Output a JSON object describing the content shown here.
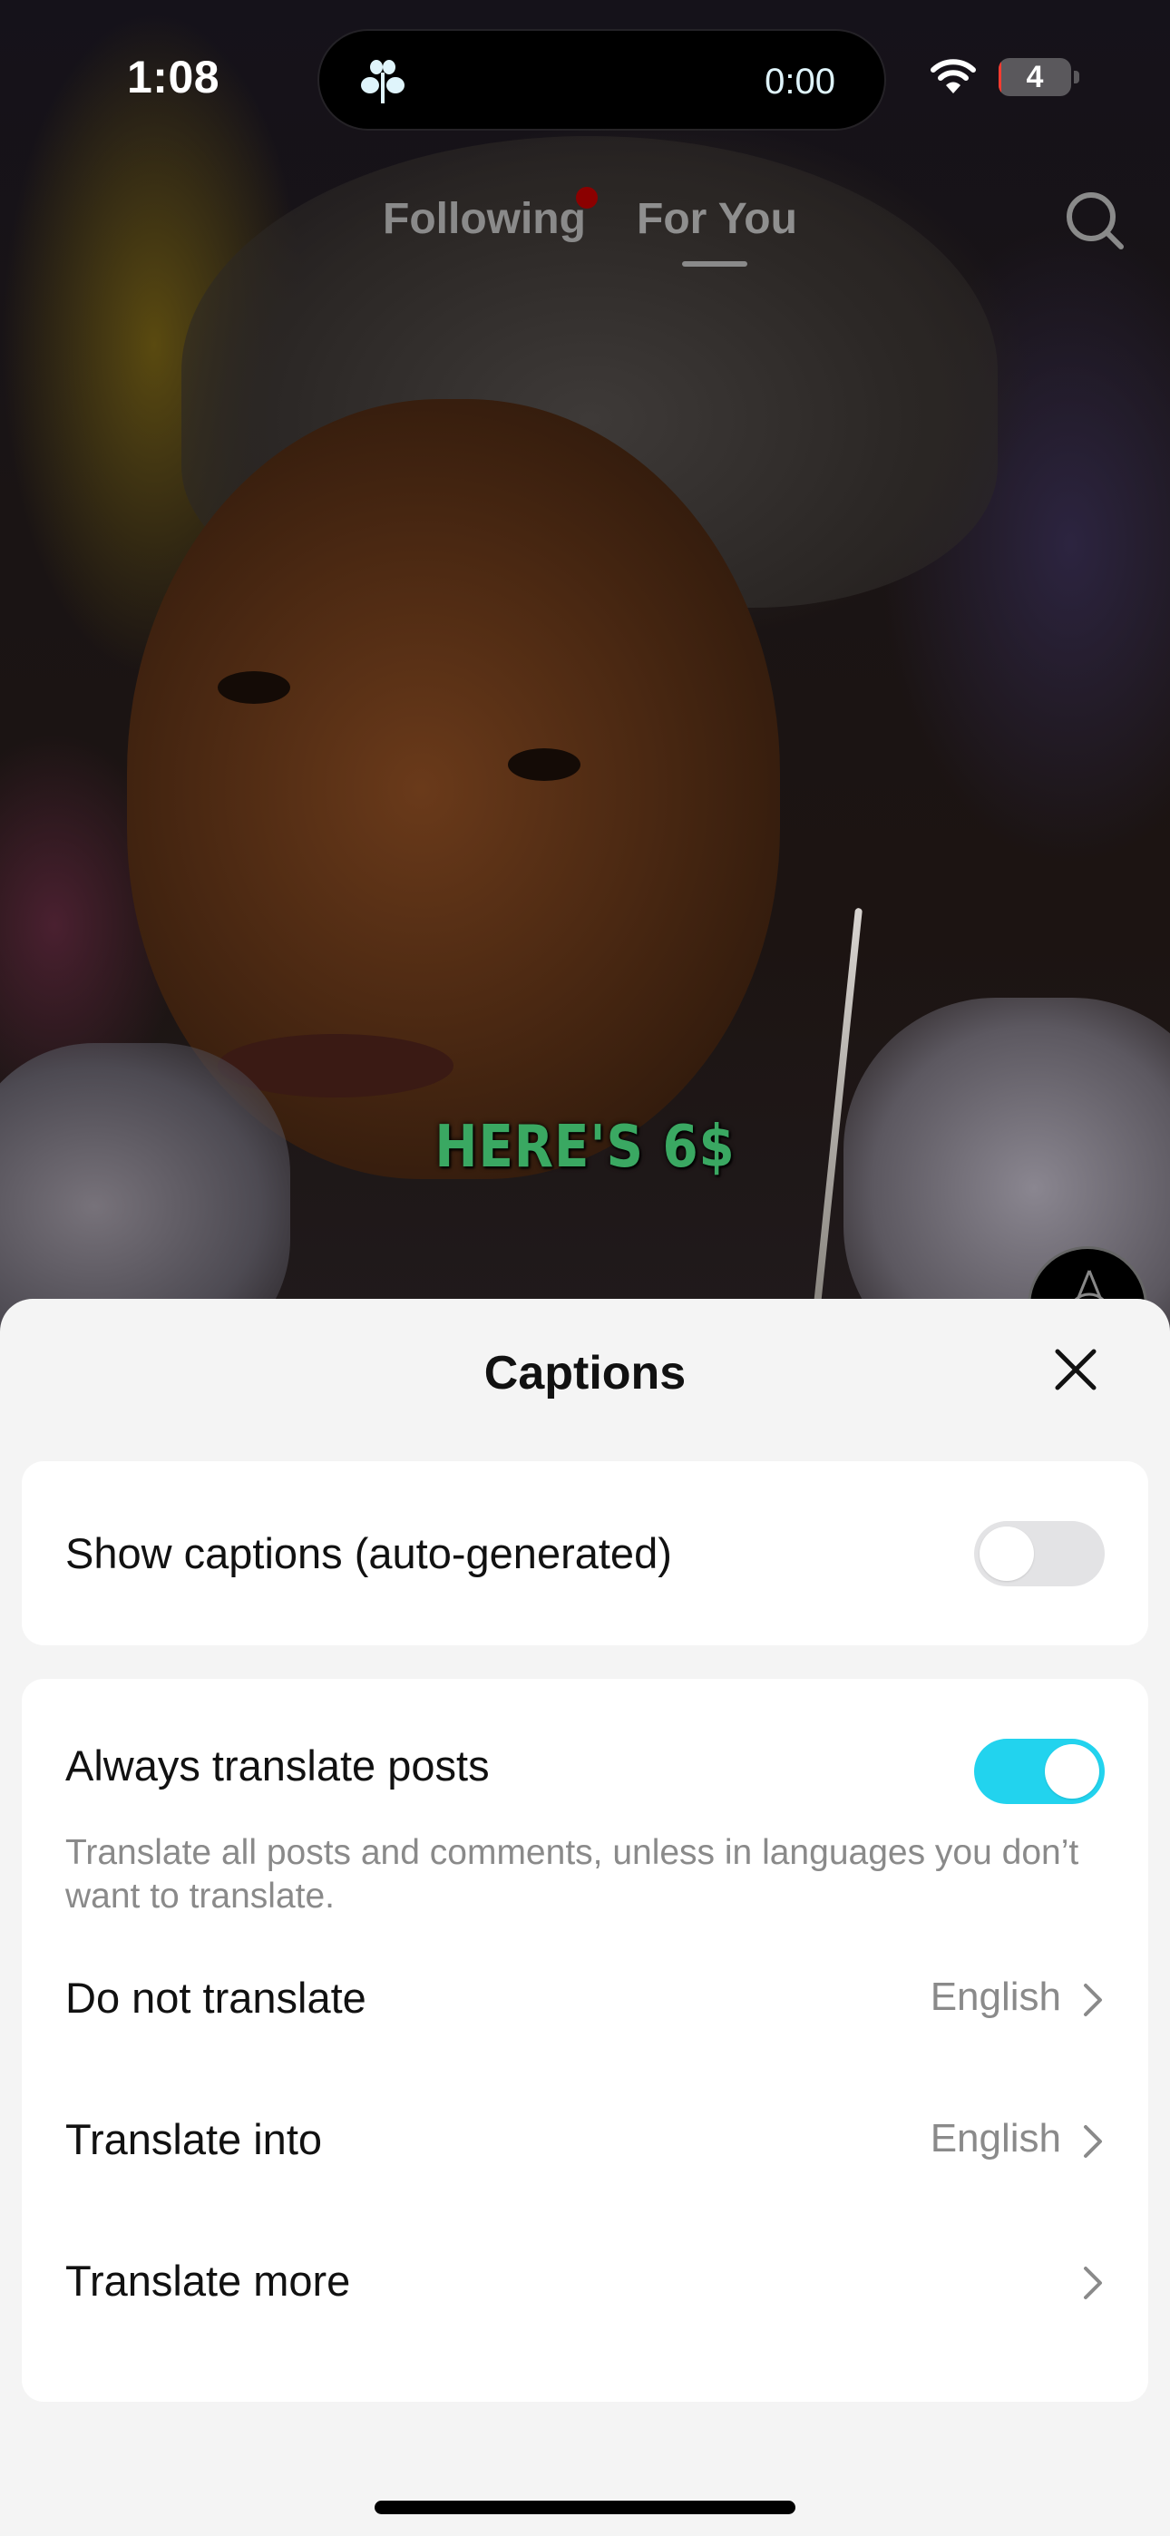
{
  "status_bar": {
    "time": "1:08",
    "live_activity_timer": "0:00",
    "live_activity_icon": "plant-sprout-icon",
    "wifi_icon": "wifi-icon",
    "battery_level": "4",
    "battery_color_low": "#ff3b30"
  },
  "feed": {
    "tabs": [
      {
        "label": "Following",
        "active": false,
        "has_notification_dot": true
      },
      {
        "label": "For You",
        "active": true
      }
    ],
    "search_icon": "search-icon",
    "notification_dot_color": "#8b0000",
    "video_caption_overlay": "HERE'S 6$",
    "music_disc_icon": "music-disc-icon"
  },
  "captions_sheet": {
    "title": "Captions",
    "close_icon": "close-icon",
    "show_captions": {
      "label": "Show captions (auto-generated)",
      "enabled": false
    },
    "always_translate": {
      "label": "Always translate posts",
      "enabled": true,
      "description": "Translate all posts and comments, unless in languages you don’t want to translate.",
      "toggle_color": "#22d3ee"
    },
    "rows": [
      {
        "label": "Do not translate",
        "value": "English"
      },
      {
        "label": "Translate into",
        "value": "English"
      },
      {
        "label": "Translate more",
        "value": ""
      }
    ]
  }
}
